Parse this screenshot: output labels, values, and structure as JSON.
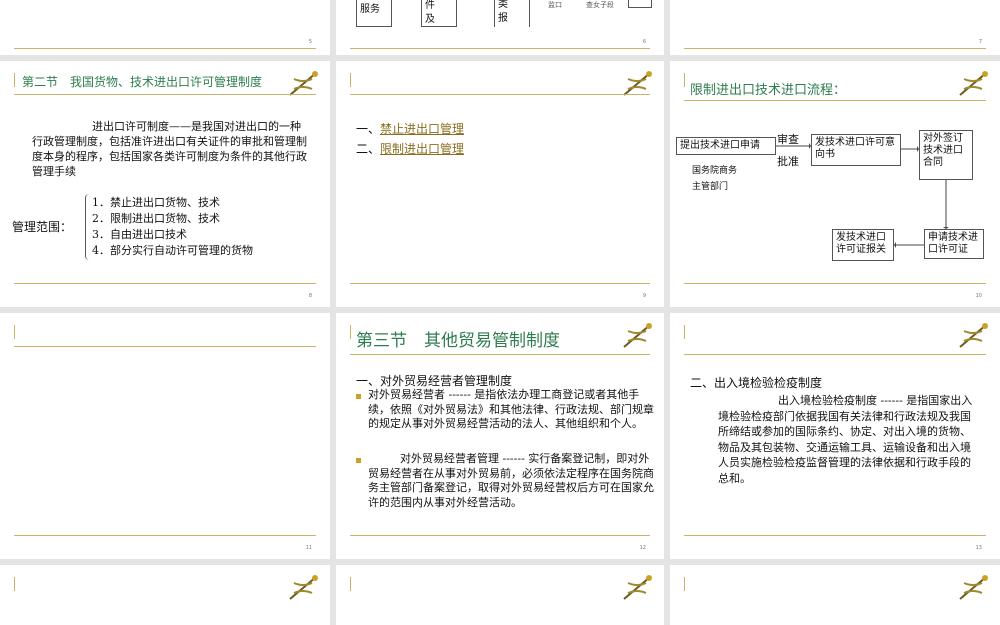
{
  "colors": {
    "gold": "#c9b46a",
    "green": "#2e7d4f",
    "link": "#8a6d1e",
    "bullet": "#c9a227"
  },
  "emblem_icon": "caduceus-emblem-icon",
  "slides": {
    "s5": {
      "num": "5",
      "cells": [
        "服务",
        "件\n及",
        "类\n报",
        "监口",
        "查女子段"
      ]
    },
    "s6": {
      "num": "6"
    },
    "s7": {
      "num": "7"
    },
    "s8": {
      "num": "8",
      "title": "第二节　我国货物、技术进出口许可管理制度",
      "para": "进出口许可制度——是我国对进出口的一种行政管理制度，包括准许进出口有关证件的审批和管理制度本身的程序，包括国家各类许可制度为条件的其他行政管理手续",
      "scope_label": "管理范围：",
      "scope_items": [
        "1．禁止进出口货物、技术",
        "2．限制进出口货物、技术",
        "3．自由进出口技术",
        "4．部分实行自动许可管理的货物"
      ]
    },
    "s9": {
      "num": "9",
      "items": [
        {
          "prefix": "一、",
          "link": "禁止进出口管理"
        },
        {
          "prefix": "二、",
          "link": "限制进出口管理"
        }
      ]
    },
    "s10": {
      "num": "10",
      "title": "限制进出口技术进口流程：",
      "b1": "提出技术进口申请",
      "b2": "发技术进口许可意向书",
      "b3": "对外签订技术进口合同",
      "b4": "申请技术进口许可证",
      "b5": "发技术进口许可证报关",
      "arrow_top": "审查",
      "arrow_bottom": "批准",
      "sub1": "国务院商务",
      "sub2": "主管部门"
    },
    "s11": {
      "num": "11"
    },
    "s12": {
      "num": "12",
      "title": "第三节　其他贸易管制制度",
      "heading": "一、对外贸易经营者管理制度",
      "bullet1": "对外贸易经营者 ------ 是指依法办理工商登记或者其他手续，依照《对外贸易法》和其他法律、行政法规、部门规章的规定从事对外贸易经营活动的法人、其他组织和个人。",
      "bullet2": "对外贸易经营者管理 ------ 实行备案登记制，即对外贸易经营者在从事对外贸易前，必须依法定程序在国务院商务主管部门备案登记，取得对外贸易经营权后方可在国家允许的范围内从事对外经营活动。"
    },
    "s13": {
      "num": "13",
      "heading": "二、出入境检验检疫制度",
      "para": "出入境检验检疫制度 ------ 是指国家出入境检验检疫部门依据我国有关法律和行政法规及我国所缔结或参加的国际条约、协定、对出入境的货物、物品及其包装物、交通运输工具、运输设备和出入境人员实施检验检疫监督管理的法律依据和行政手段的总和。"
    }
  }
}
